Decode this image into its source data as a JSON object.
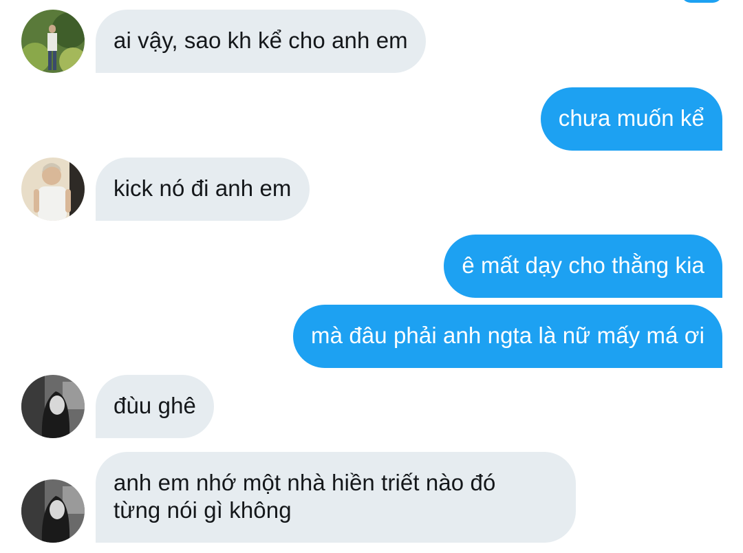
{
  "conversation": {
    "messages": [
      {
        "side": "in",
        "avatar": "avatar-1",
        "text": "ai vậy, sao kh kể cho anh em"
      },
      {
        "side": "out",
        "text": "chưa muốn kể"
      },
      {
        "side": "in",
        "avatar": "avatar-2",
        "text": "kick nó đi anh em"
      },
      {
        "side": "out",
        "text": "ê mất dạy cho thằng kia"
      },
      {
        "side": "out",
        "text": "mà đâu phải anh ngta là nữ mấy má ơi"
      },
      {
        "side": "in",
        "avatar": "avatar-3",
        "text": "đùu ghê"
      },
      {
        "side": "in",
        "avatar": "avatar-3",
        "lines": [
          "anh em nhớ một nhà hiền triết nào đó",
          "từng nói gì không"
        ]
      }
    ]
  },
  "colors": {
    "outgoing_bubble": "#1da1f2",
    "incoming_bubble": "#e6ecf0",
    "incoming_text": "#14171a",
    "outgoing_text": "#ffffff"
  }
}
